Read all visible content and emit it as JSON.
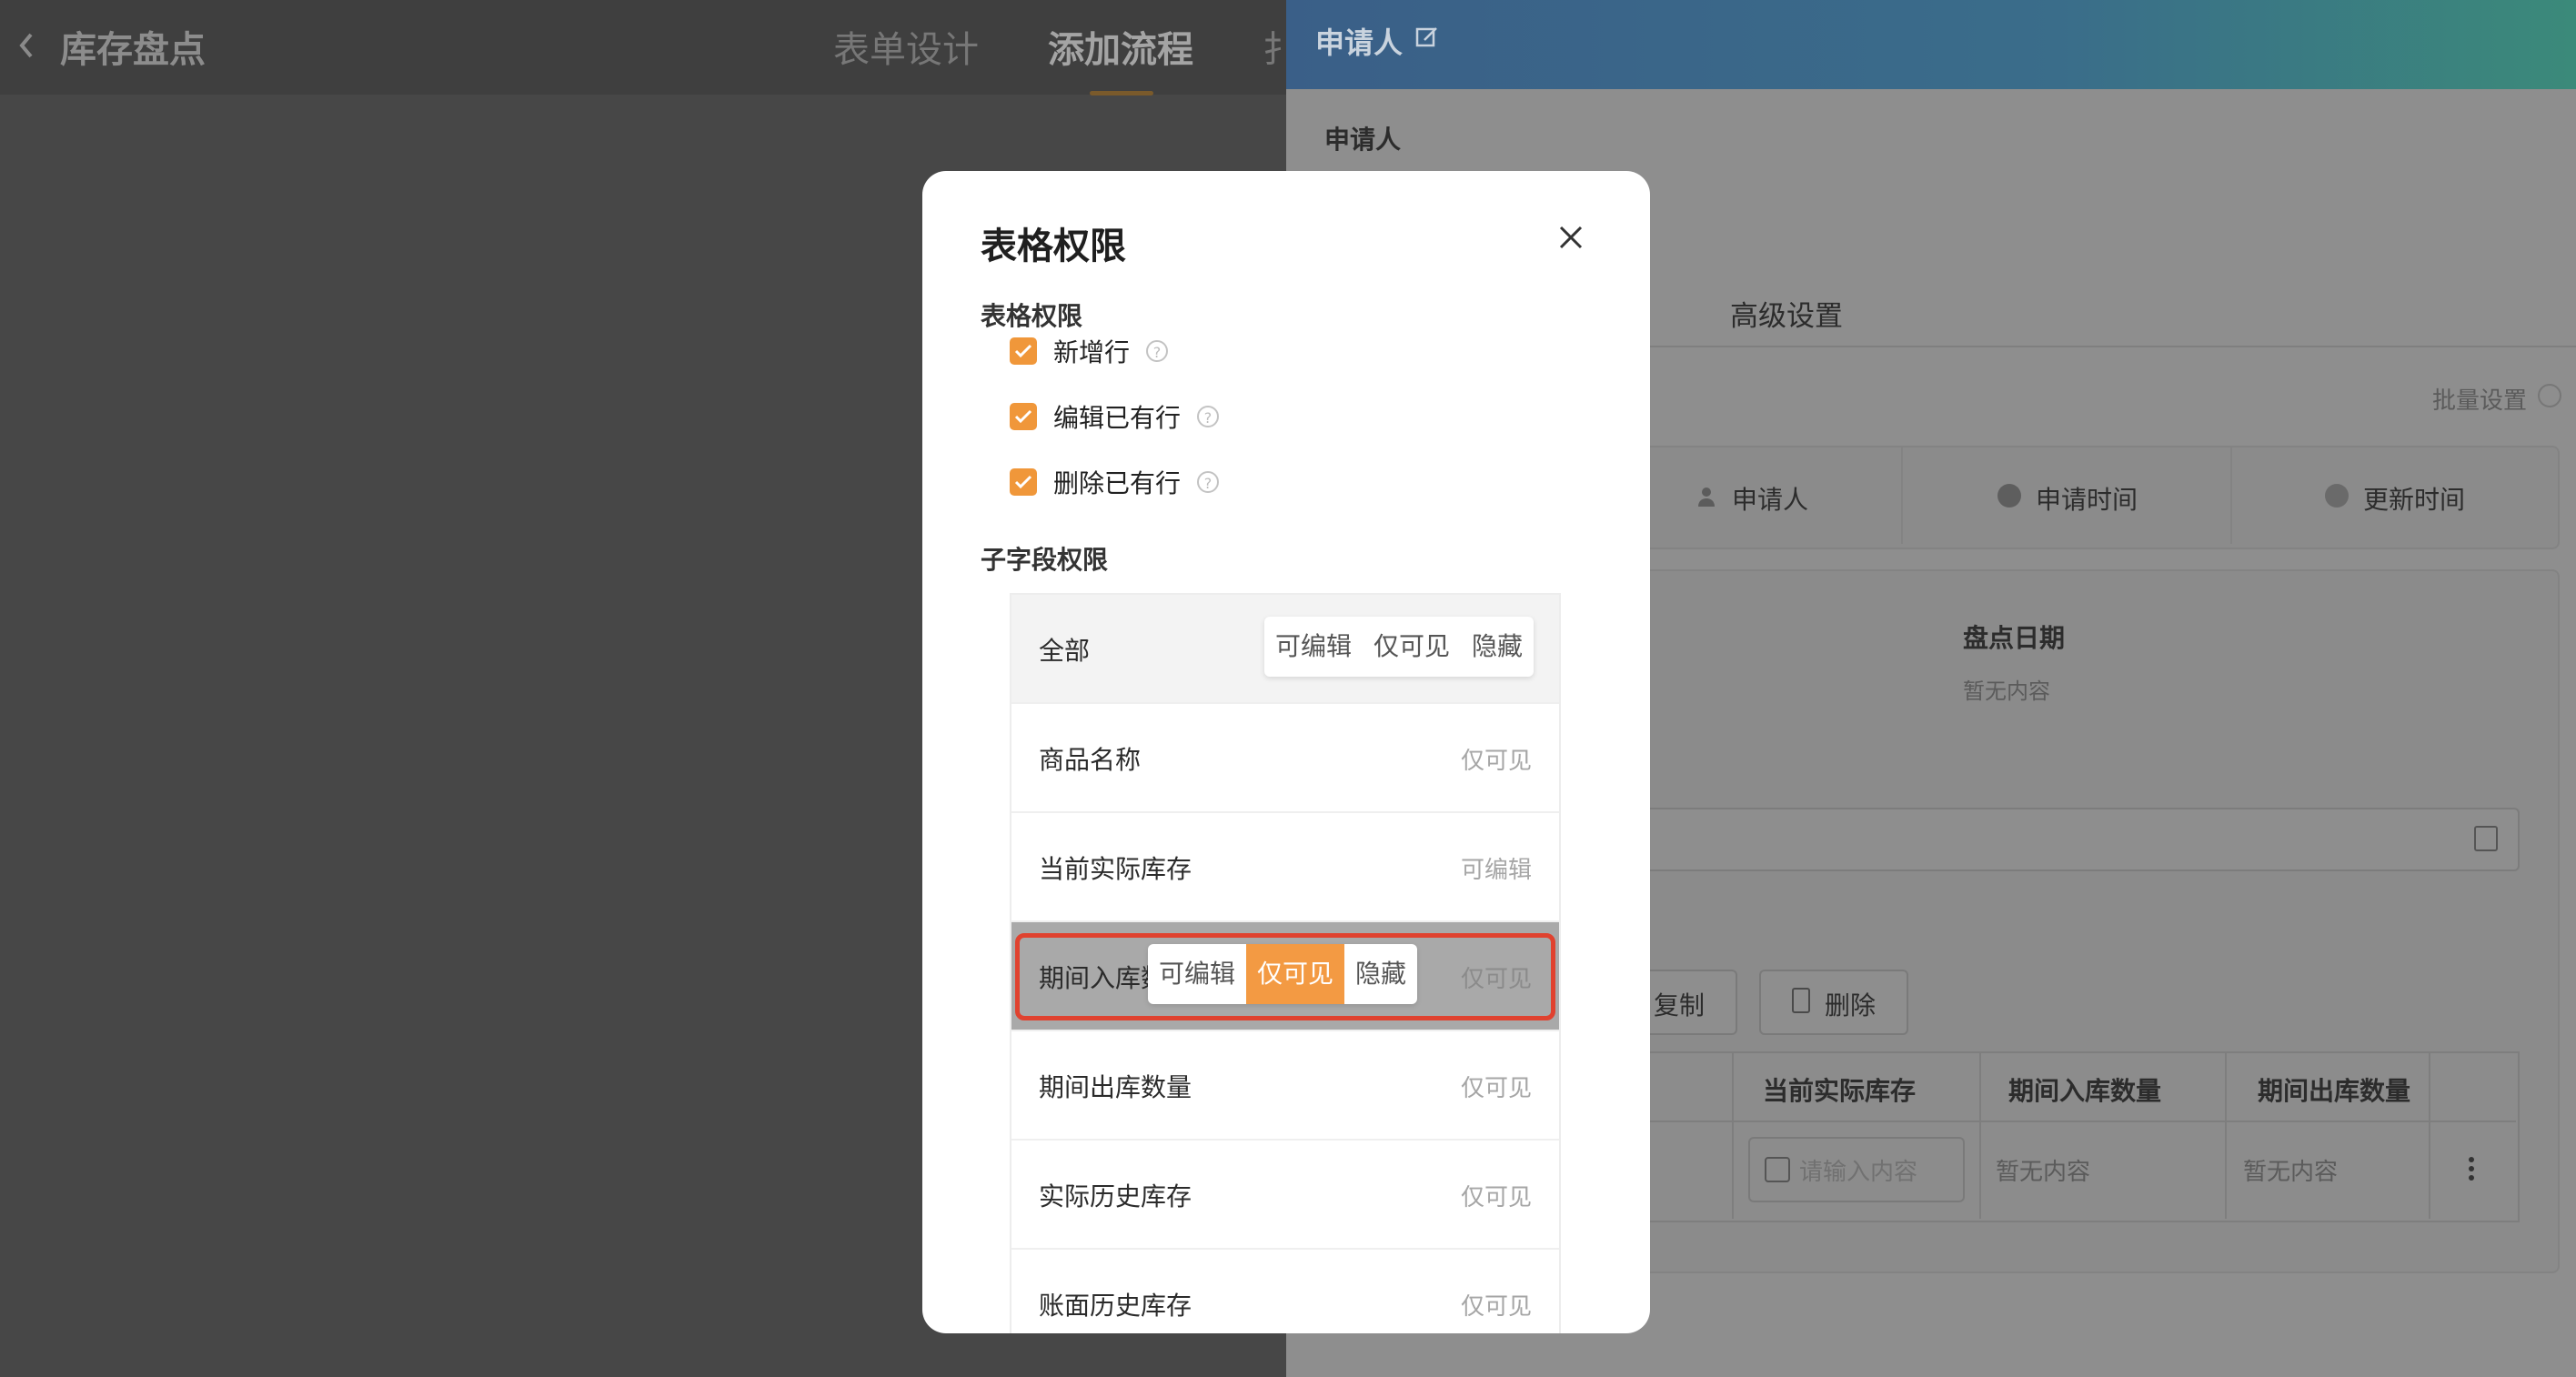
{
  "header": {
    "back_icon": "chevron-left-icon",
    "title": "库存盘点",
    "tabs": [
      {
        "label": "表单设计",
        "active": false
      },
      {
        "label": "添加流程",
        "active": true
      },
      {
        "label": "扌",
        "active": false
      }
    ]
  },
  "drawer": {
    "title": "申请人",
    "edit_icon": "edit-icon",
    "section_label": "申请人",
    "tab_advanced": "高级设置",
    "batch_settings": "批量设置",
    "fields": [
      {
        "icon": "user-icon",
        "label": "申请人"
      },
      {
        "icon": "clock-icon",
        "label": "申请时间"
      },
      {
        "icon": "globe-icon",
        "label": "更新时间"
      }
    ],
    "date_label": "盘点日期",
    "date_empty": "暂无内容",
    "copy_button": "复制",
    "delete_button": "删除",
    "table_headers": [
      "当前实际库存",
      "期间入库数量",
      "期间出库数量"
    ],
    "table_row": {
      "input_placeholder": "请输入内容",
      "col2": "暂无内容",
      "col3": "暂无内容"
    }
  },
  "modal": {
    "title": "表格权限",
    "close_icon": "close-icon",
    "table_perm_title": "表格权限",
    "checkboxes": [
      {
        "label": "新增行",
        "checked": true
      },
      {
        "label": "编辑已有行",
        "checked": true
      },
      {
        "label": "删除已有行",
        "checked": true
      }
    ],
    "subfield_title": "子字段权限",
    "all_row": {
      "label": "全部",
      "options": [
        "可编辑",
        "仅可见",
        "隐藏"
      ]
    },
    "rows": [
      {
        "name": "商品名称",
        "perm": "仅可见"
      },
      {
        "name": "当前实际库存",
        "perm": "可编辑"
      },
      {
        "name": "期间入库数",
        "perm": "仅可见"
      },
      {
        "name": "期间出库数量",
        "perm": "仅可见"
      },
      {
        "name": "实际历史库存",
        "perm": "仅可见"
      },
      {
        "name": "账面历史库存",
        "perm": "仅可见"
      }
    ],
    "popup_options": [
      "可编辑",
      "仅可见",
      "隐藏"
    ],
    "popup_selected": "仅可见",
    "accent_color": "#f39a43",
    "highlight_color": "#e0422f"
  }
}
